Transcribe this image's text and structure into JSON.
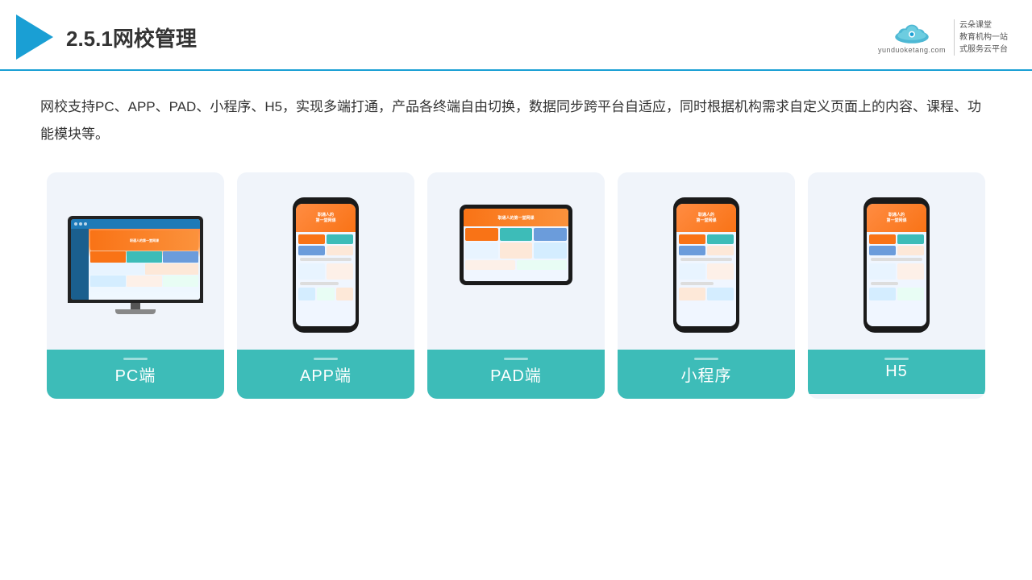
{
  "header": {
    "title": "2.5.1网校管理",
    "brand_name": "云朵课堂",
    "brand_url": "yunduoketang.com",
    "brand_tagline_1": "教育机构一站",
    "brand_tagline_2": "式服务云平台"
  },
  "description": "网校支持PC、APP、PAD、小程序、H5，实现多端打通，产品各终端自由切换，数据同步跨平台自适应，同时根据机构需求自定义页面上的内容、课程、功能模块等。",
  "cards": [
    {
      "id": "pc",
      "label": "PC端",
      "type": "pc"
    },
    {
      "id": "app",
      "label": "APP端",
      "type": "phone"
    },
    {
      "id": "pad",
      "label": "PAD端",
      "type": "tablet"
    },
    {
      "id": "miniapp",
      "label": "小程序",
      "type": "phone2"
    },
    {
      "id": "h5",
      "label": "H5",
      "type": "phone3"
    }
  ],
  "colors": {
    "accent": "#3dbcb8",
    "header_border": "#1a9fd4",
    "logo_blue": "#1a9fd4",
    "card_bg": "#f0f4fa"
  }
}
